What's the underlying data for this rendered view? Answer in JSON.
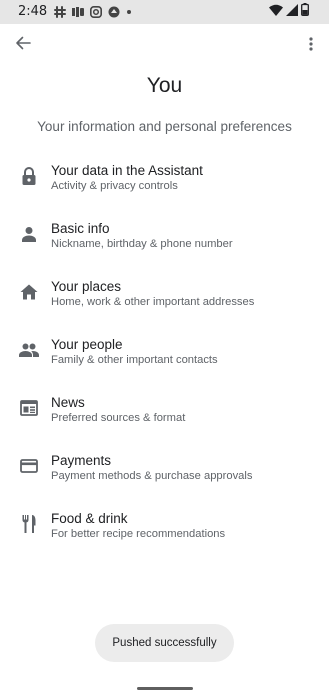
{
  "status_bar": {
    "time": "2:48",
    "left_icons": [
      "slack-icon",
      "notification-icon",
      "instagram-icon",
      "app-icon",
      "dot-icon"
    ],
    "right_icons": [
      "wifi-icon",
      "signal-icon",
      "battery-icon"
    ]
  },
  "app_bar": {
    "back_icon": "arrow-back-icon",
    "menu_icon": "more-vert-icon"
  },
  "header": {
    "title": "You",
    "subtitle": "Your information and personal preferences"
  },
  "items": [
    {
      "icon": "lock-icon",
      "title": "Your data in the Assistant",
      "subtitle": "Activity & privacy controls"
    },
    {
      "icon": "person-icon",
      "title": "Basic info",
      "subtitle": "Nickname, birthday & phone number"
    },
    {
      "icon": "home-icon",
      "title": "Your places",
      "subtitle": "Home, work & other important addresses"
    },
    {
      "icon": "people-icon",
      "title": "Your people",
      "subtitle": "Family & other important contacts"
    },
    {
      "icon": "news-icon",
      "title": "News",
      "subtitle": "Preferred sources & format"
    },
    {
      "icon": "credit-card-icon",
      "title": "Payments",
      "subtitle": "Payment methods & purchase approvals"
    },
    {
      "icon": "restaurant-icon",
      "title": "Food & drink",
      "subtitle": "For better recipe recommendations"
    }
  ],
  "toast": {
    "message": "Pushed successfully"
  },
  "colors": {
    "status_bar_bg": "#e6e6e6",
    "primary_text": "#202124",
    "secondary_text": "#5f6368",
    "icon": "#5f6368",
    "toast_bg": "#ececec"
  }
}
